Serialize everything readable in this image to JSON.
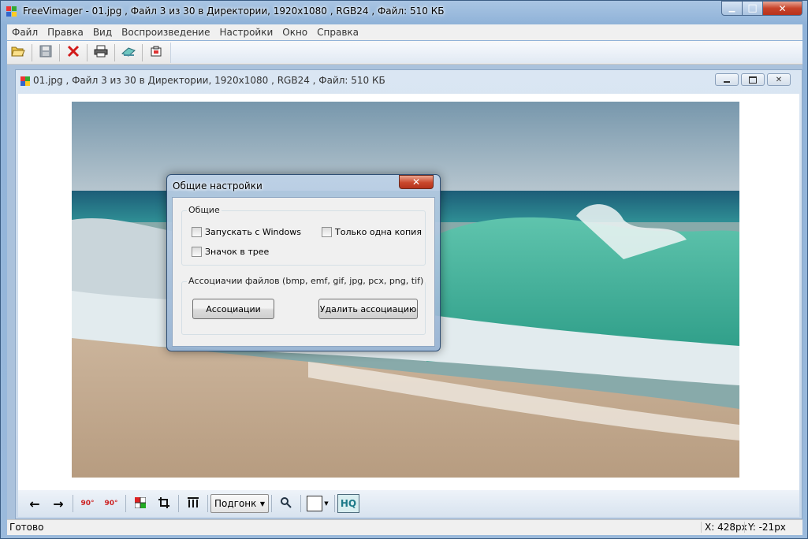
{
  "window": {
    "title": "FreeVimager - 01.jpg , Файл  3 из 30 в Директории, 1920x1080 , RGB24 , Файл: 510 КБ",
    "minimize": "▁",
    "maximize": "□",
    "close": "✕"
  },
  "menu": [
    "Файл",
    "Правка",
    "Вид",
    "Воспроизведение",
    "Настройки",
    "Окно",
    "Справка"
  ],
  "toolbar": {
    "icons": [
      "open-folder-icon",
      "save-icon",
      "delete-icon",
      "print-icon",
      "scan-icon",
      "capture-icon"
    ]
  },
  "child": {
    "title": "01.jpg , Файл  3 из 30 в Директории, 1920x1080 , RGB24 , Файл: 510 КБ"
  },
  "bottom_toolbar": {
    "zoom_mode": "Подгонк",
    "hq_label": "HQ",
    "rotate_left_label": "90°",
    "rotate_right_label": "90°"
  },
  "status": {
    "ready": "Готово",
    "x": "X: 428px",
    "y": "Y: -21px"
  },
  "dialog": {
    "title": "Общие настройки",
    "close": "✕",
    "group_general": "Общие",
    "cb_windows": "Запускать с Windows",
    "cb_single": "Только одна копия",
    "cb_tray": "Значок в трее",
    "group_assoc": "Ассоциачии файлов (bmp, emf, gif, jpg, pcx, png, tif)",
    "btn_assoc": "Ассоциации",
    "btn_remove": "Удалить ассоциацию"
  }
}
